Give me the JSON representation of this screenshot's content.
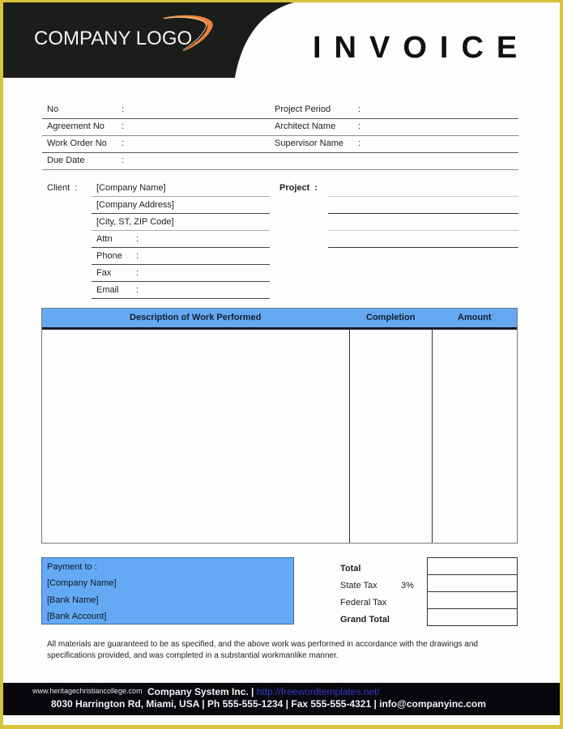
{
  "header": {
    "logo_text": "COMPANY LOGO",
    "title": "INVOICE",
    "band_color": "#1a1d19",
    "swoosh_color": "#e8843a"
  },
  "info": {
    "left": [
      {
        "label": "No",
        "colon": ":"
      },
      {
        "label": "Agreement No",
        "colon": ":"
      },
      {
        "label": "Work Order No",
        "colon": ":"
      },
      {
        "label": "Due Date",
        "colon": ":"
      }
    ],
    "right": [
      {
        "label": "Project Period",
        "colon": ":"
      },
      {
        "label": "Architect Name",
        "colon": ":"
      },
      {
        "label": "Supervisor Name",
        "colon": ":"
      }
    ]
  },
  "client": {
    "label": "Client  :",
    "lines": [
      "[Company Name]",
      "[Company Address]",
      "[City, ST, ZIP Code]"
    ],
    "fields": [
      {
        "label": "Attn",
        "colon": ":"
      },
      {
        "label": "Phone",
        "colon": ":"
      },
      {
        "label": "Fax",
        "colon": ":"
      },
      {
        "label": "Email",
        "colon": ":"
      }
    ]
  },
  "project": {
    "label": "Project  :"
  },
  "work_table": {
    "header_color": "#66a8f0",
    "columns": [
      "Description of Work Performed",
      "Completion",
      "Amount"
    ],
    "rows": []
  },
  "payment": {
    "title": "Payment to :",
    "lines": [
      "[Company Name]",
      "[Bank Name]",
      "[Bank Account]"
    ],
    "box_color": "#64a9f3"
  },
  "totals": {
    "total": "Total",
    "state_tax": "State Tax",
    "state_tax_rate": "3%",
    "federal_tax": "Federal Tax",
    "grand_total": "Grand Total"
  },
  "disclaimer": "All materials are guaranteed to be as specified, and the above work was performed in accordance with the drawings and specifications provided, and was completed in a substantial workmanlike manner.",
  "footer": {
    "watermark": "www.heritagechristiancollege.com",
    "company": "Company System Inc. |",
    "link": "http://freewordtemplates.net/",
    "address_line": "8030 Harrington Rd, Miami, USA | Ph 555-555-1234 | Fax 555-555-4321 | info@companyinc.com"
  }
}
